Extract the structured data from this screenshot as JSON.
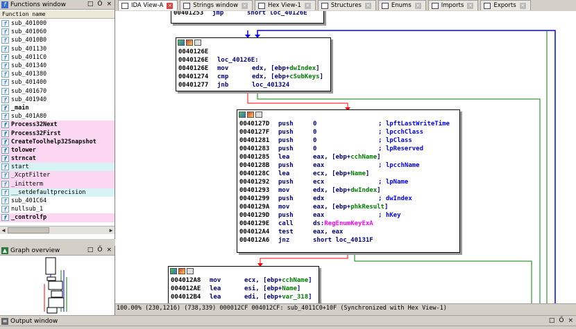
{
  "functions_window": {
    "title": "Functions window",
    "column_header": "Function name",
    "items": [
      {
        "name": "sub_401000",
        "style": "normal"
      },
      {
        "name": "sub_401060",
        "style": "normal"
      },
      {
        "name": "sub_4010B0",
        "style": "normal"
      },
      {
        "name": "sub_401130",
        "style": "normal"
      },
      {
        "name": "sub_4011C0",
        "style": "normal"
      },
      {
        "name": "sub_401340",
        "style": "normal"
      },
      {
        "name": "sub_401380",
        "style": "normal"
      },
      {
        "name": "sub_401400",
        "style": "normal"
      },
      {
        "name": "sub_401670",
        "style": "normal"
      },
      {
        "name": "sub_401940",
        "style": "normal"
      },
      {
        "name": "_main",
        "style": "bold"
      },
      {
        "name": "sub_401A80",
        "style": "normal"
      },
      {
        "name": "Process32Next",
        "style": "lib"
      },
      {
        "name": "Process32First",
        "style": "lib"
      },
      {
        "name": "CreateToolhelp32Snapshot",
        "style": "lib"
      },
      {
        "name": "tolower",
        "style": "lib"
      },
      {
        "name": "strncat",
        "style": "lib"
      },
      {
        "name": "start",
        "style": "startrow"
      },
      {
        "name": "_XcptFilter",
        "style": "libthin"
      },
      {
        "name": "_initterm",
        "style": "libthin"
      },
      {
        "name": "__setdefaultprecision",
        "style": "startrow"
      },
      {
        "name": "sub_401C64",
        "style": "normal"
      },
      {
        "name": "nullsub_1",
        "style": "normal"
      },
      {
        "name": "_controlfp",
        "style": "lib"
      }
    ]
  },
  "graph_overview": {
    "title": "Graph overview"
  },
  "tabs": [
    {
      "label": "IDA View-A",
      "icon": "ida-view-icon",
      "active": true
    },
    {
      "label": "Strings window",
      "icon": "strings-icon",
      "active": false
    },
    {
      "label": "Hex View-1",
      "icon": "hex-view-icon",
      "active": false
    },
    {
      "label": "Structures",
      "icon": "structures-icon",
      "active": false
    },
    {
      "label": "Enums",
      "icon": "enums-icon",
      "active": false
    },
    {
      "label": "Imports",
      "icon": "imports-icon",
      "active": false
    },
    {
      "label": "Exports",
      "icon": "exports-icon",
      "active": false
    }
  ],
  "nodes": {
    "top": {
      "lines": [
        {
          "addr": "00401253",
          "mn": "jmp",
          "op": "short loc_40126E"
        }
      ]
    },
    "n1": {
      "lines": [
        {
          "addr": "0040126E",
          "mn": "",
          "op": ""
        },
        {
          "addr": "0040126E",
          "mn": "loc_40126E:",
          "op": ""
        },
        {
          "addr": "0040126E",
          "mn": "mov",
          "op": "edx, [ebp+",
          "var": "dwIndex",
          "op2": "]"
        },
        {
          "addr": "00401274",
          "mn": "cmp",
          "op": "edx, [ebp+",
          "var": "cSubKeys",
          "op2": "]"
        },
        {
          "addr": "00401277",
          "mn": "jnb",
          "op": "loc_401324"
        }
      ]
    },
    "n2": {
      "lines": [
        {
          "addr": "0040127D",
          "mn": "push",
          "op": "0",
          "cmt": "; lpftLastWriteTime"
        },
        {
          "addr": "0040127F",
          "mn": "push",
          "op": "0",
          "cmt": "; lpcchClass"
        },
        {
          "addr": "00401281",
          "mn": "push",
          "op": "0",
          "cmt": "; lpClass"
        },
        {
          "addr": "00401283",
          "mn": "push",
          "op": "0",
          "cmt": "; lpReserved"
        },
        {
          "addr": "00401285",
          "mn": "lea",
          "op": "eax, [ebp+",
          "var": "cchName",
          "op2": "]"
        },
        {
          "addr": "0040128B",
          "mn": "push",
          "op": "eax",
          "cmt": "; lpcchName"
        },
        {
          "addr": "0040128C",
          "mn": "lea",
          "op": "ecx, [ebp+",
          "var": "Name",
          "op2": "]"
        },
        {
          "addr": "00401292",
          "mn": "push",
          "op": "ecx",
          "cmt": "; lpName"
        },
        {
          "addr": "00401293",
          "mn": "mov",
          "op": "edx, [ebp+",
          "var": "dwIndex",
          "op2": "]"
        },
        {
          "addr": "00401299",
          "mn": "push",
          "op": "edx",
          "cmt": "; dwIndex"
        },
        {
          "addr": "0040129A",
          "mn": "mov",
          "op": "eax, [ebp+",
          "var": "phkResult",
          "op2": "]"
        },
        {
          "addr": "0040129D",
          "mn": "push",
          "op": "eax",
          "cmt": "; hKey"
        },
        {
          "addr": "0040129E",
          "mn": "call",
          "op": "ds:",
          "api": "RegEnumKeyExA"
        },
        {
          "addr": "004012A4",
          "mn": "test",
          "op": "eax, eax"
        },
        {
          "addr": "004012A6",
          "mn": "jnz",
          "op": "short loc_40131F"
        }
      ]
    },
    "n3": {
      "lines": [
        {
          "addr": "004012A8",
          "mn": "mov",
          "op": "ecx, [ebp+",
          "var": "cchName",
          "op2": "]"
        },
        {
          "addr": "004012AE",
          "mn": "lea",
          "op": "esi, [ebp+",
          "var": "Name",
          "op2": "]"
        },
        {
          "addr": "004012B4",
          "mn": "lea",
          "op": "edi, [ebp+",
          "var": "var_318",
          "op2": "]"
        }
      ]
    }
  },
  "status_bar": "100.00% (230,1216) (738,339) 000012CF 004012CF: sub_4011C0+10F (Synchronized with Hex View-1)",
  "output_window": {
    "title": "Output window"
  },
  "pane_controls": {
    "restore": "□",
    "float": "Ő",
    "close": "×"
  },
  "colors": {
    "edge_blue": "#0000ff",
    "edge_red": "#ff0000",
    "edge_green": "#008000",
    "lib_bg": "#fbd7f2"
  }
}
